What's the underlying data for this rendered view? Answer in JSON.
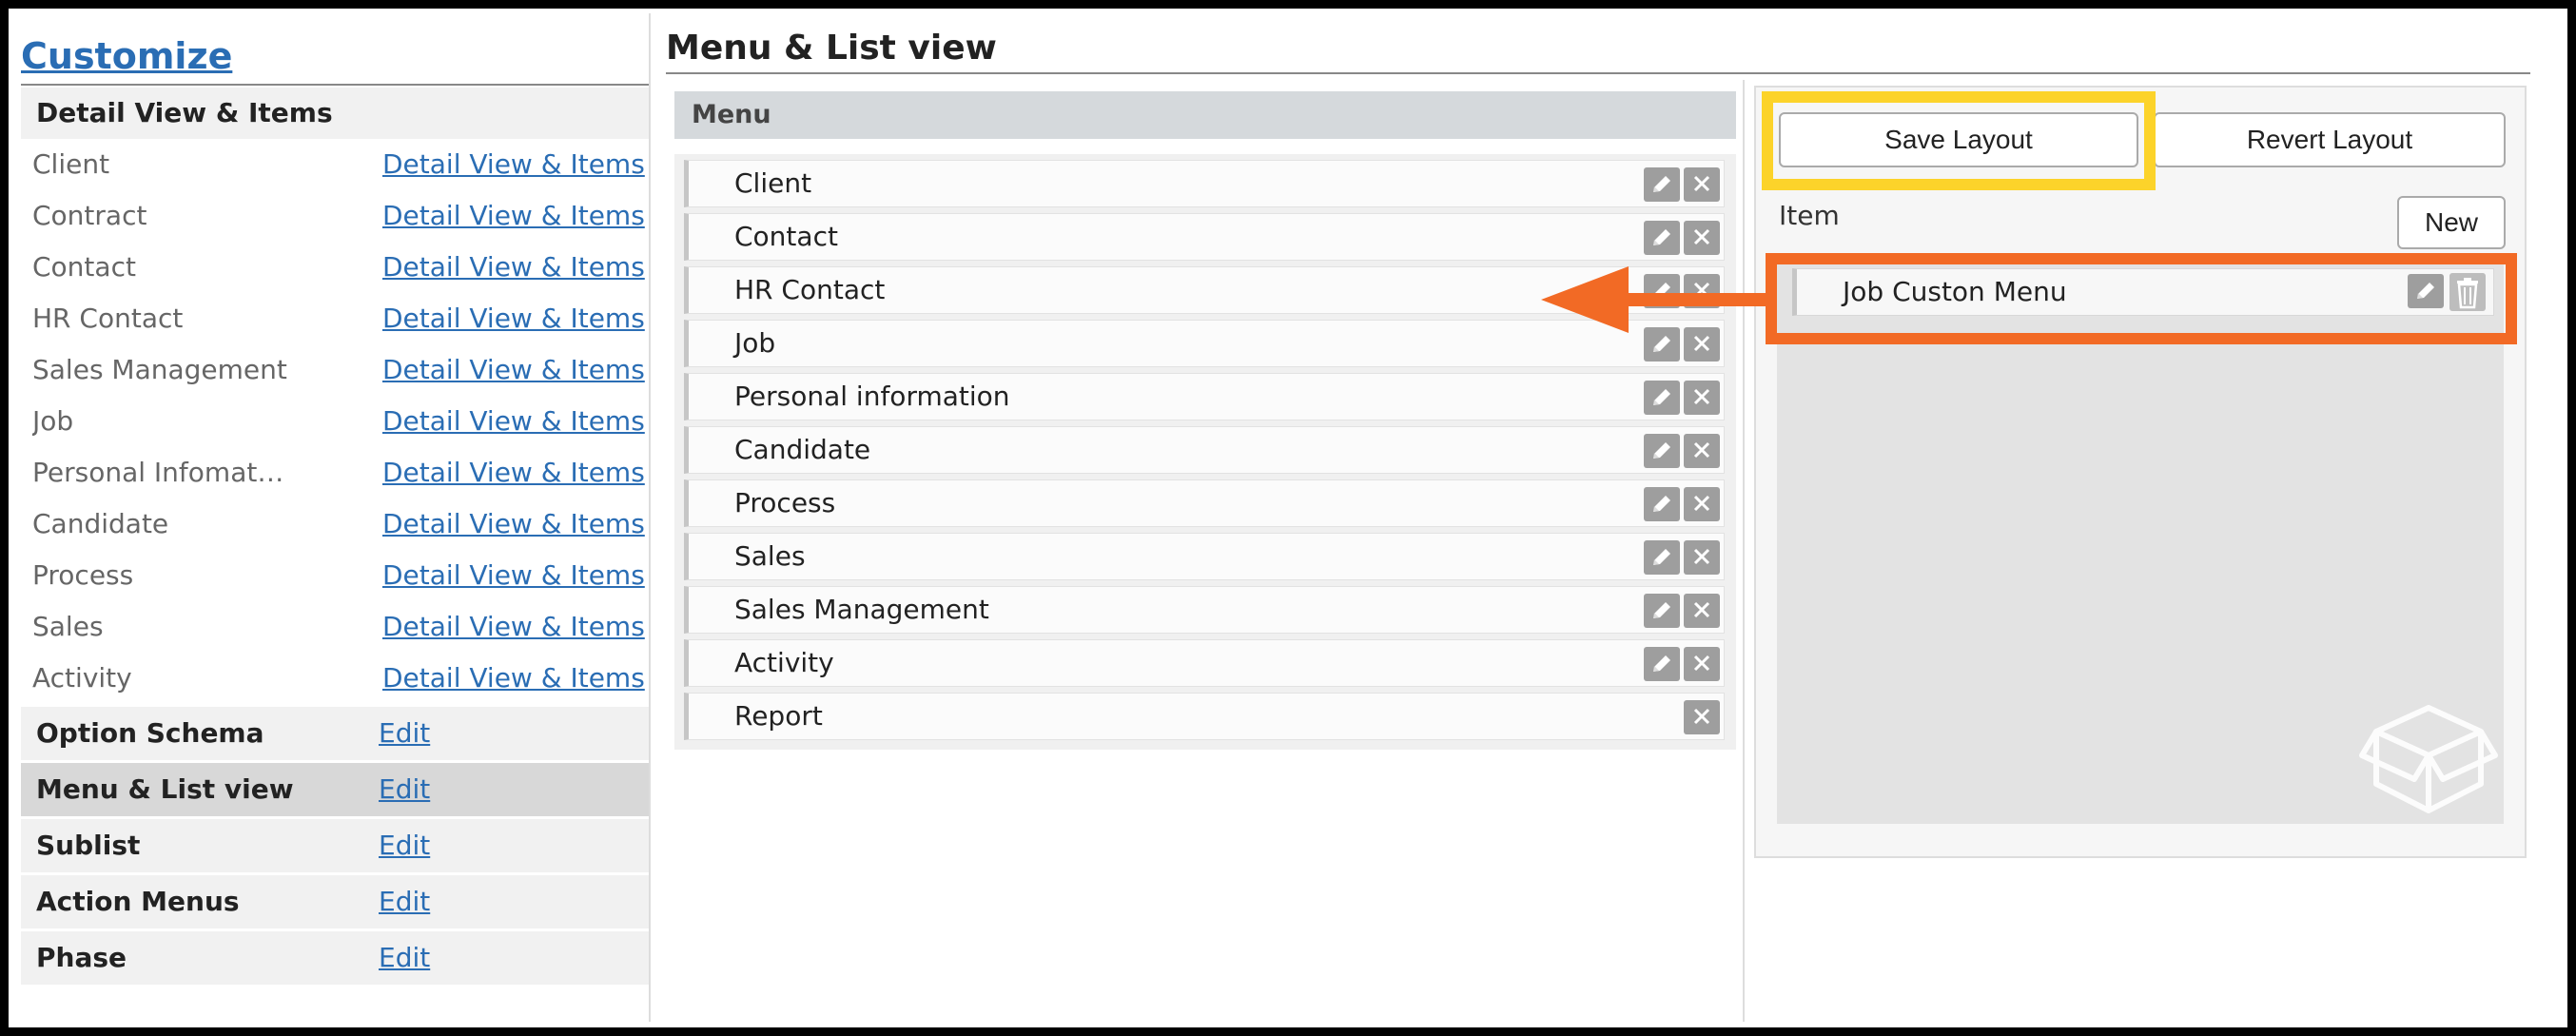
{
  "sidebar": {
    "title": "Customize",
    "section_head": "Detail View & Items",
    "detail_items": [
      {
        "label": "Client",
        "link": "Detail View & Items"
      },
      {
        "label": "Contract",
        "link": "Detail View & Items"
      },
      {
        "label": "Contact",
        "link": "Detail View & Items"
      },
      {
        "label": "HR Contact",
        "link": "Detail View & Items"
      },
      {
        "label": "Sales Management",
        "link": "Detail View & Items"
      },
      {
        "label": "Job",
        "link": "Detail View & Items"
      },
      {
        "label": "Personal Infomati⋯",
        "link": "Detail View & Items"
      },
      {
        "label": "Candidate",
        "link": "Detail View & Items"
      },
      {
        "label": "Process",
        "link": "Detail View & Items"
      },
      {
        "label": "Sales",
        "link": "Detail View & Items"
      },
      {
        "label": "Activity",
        "link": "Detail View & Items"
      }
    ],
    "groups": [
      {
        "label": "Option Schema",
        "link": "Edit"
      },
      {
        "label": "Menu & List view",
        "link": "Edit"
      },
      {
        "label": "Sublist",
        "link": "Edit"
      },
      {
        "label": "Action Menus",
        "link": "Edit"
      },
      {
        "label": "Phase",
        "link": "Edit"
      }
    ]
  },
  "main": {
    "title": "Menu & List view",
    "menu_header": "Menu",
    "menu_items": [
      "Client",
      "Contact",
      "HR Contact",
      "Job",
      "Personal information",
      "Candidate",
      "Process",
      "Sales",
      "Sales Management",
      "Activity",
      "Report"
    ]
  },
  "right": {
    "save_label": "Save Layout",
    "revert_label": "Revert Layout",
    "item_label": "Item",
    "new_label": "New",
    "item_entry": "Job Custon Menu"
  },
  "colors": {
    "link": "#2a6db4",
    "highlight_yellow": "#fcd32a",
    "highlight_orange": "#f26a25"
  }
}
